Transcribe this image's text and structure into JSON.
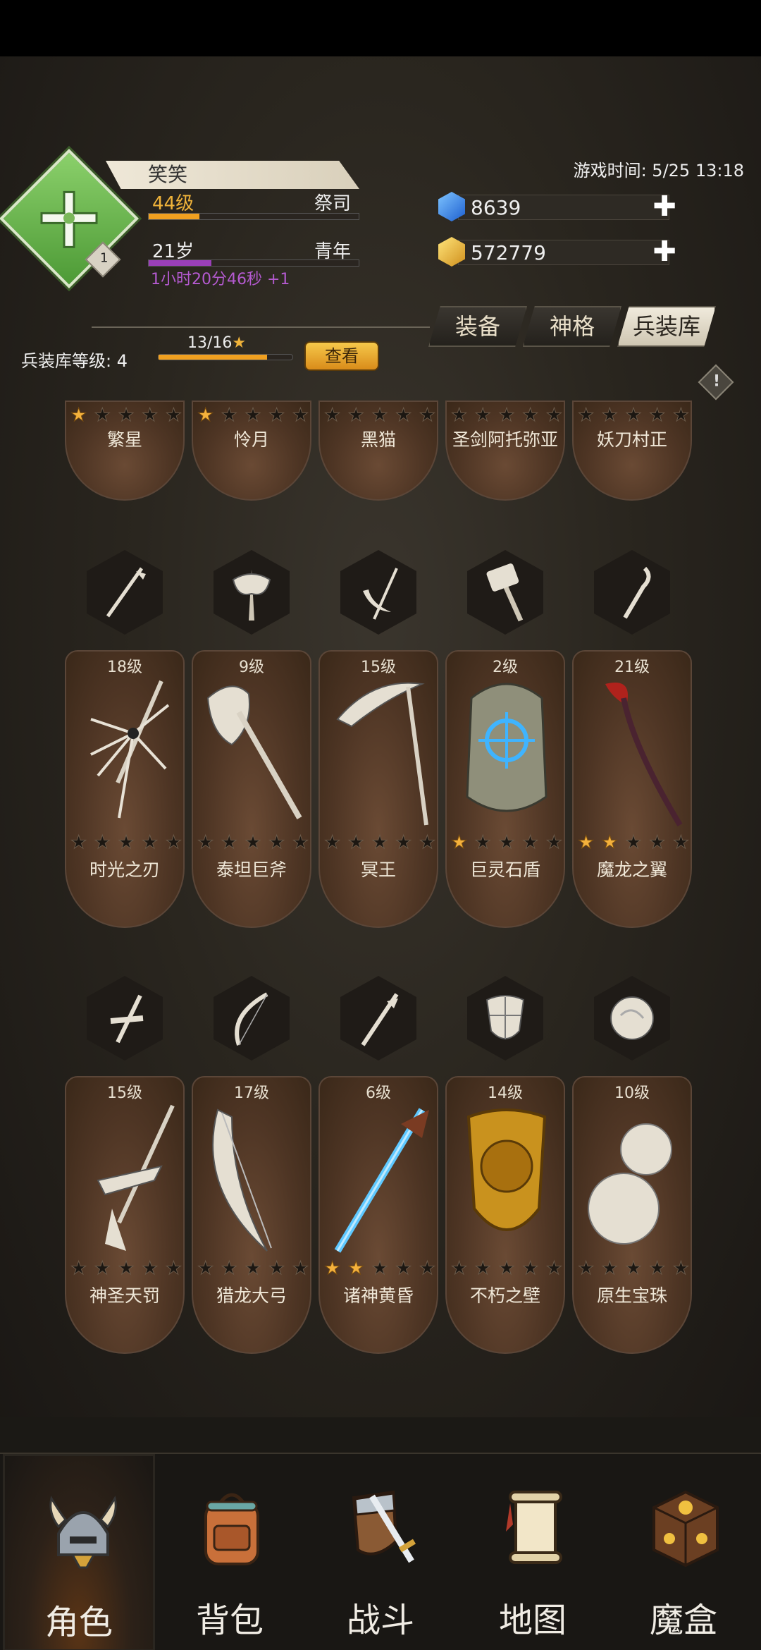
{
  "player": {
    "name": "笑笑",
    "level": "44级",
    "job": "祭司",
    "age": "21岁",
    "life_stage": "青年",
    "timer": "1小时20分46秒 +1",
    "rank": "1",
    "level_progress": 0.24,
    "age_progress": 0.3
  },
  "game_time": "游戏时间: 5/25 13:18",
  "currency": {
    "diamond": "8639",
    "gold": "572779",
    "plus": "✚"
  },
  "tabs": [
    {
      "label": "装备"
    },
    {
      "label": "神格"
    },
    {
      "label": "兵装库"
    }
  ],
  "arsenal": {
    "level_label": "兵装库等级:",
    "level": "4",
    "progress": "13/16",
    "star": "★",
    "progress_fraction": 0.8125,
    "view_button": "查看"
  },
  "info_icon": "!",
  "weapons_row0": [
    {
      "name": "繁星",
      "stars": 1
    },
    {
      "name": "怜月",
      "stars": 1
    },
    {
      "name": "黑猫",
      "stars": 0
    },
    {
      "name": "圣剑阿托弥亚",
      "stars": 0
    },
    {
      "name": "妖刀村正",
      "stars": 0
    }
  ],
  "weapons_row1": [
    {
      "level": "18级",
      "name": "时光之刃",
      "stars": 0
    },
    {
      "level": "9级",
      "name": "泰坦巨斧",
      "stars": 0
    },
    {
      "level": "15级",
      "name": "冥王",
      "stars": 0
    },
    {
      "level": "2级",
      "name": "巨灵石盾",
      "stars": 1
    },
    {
      "level": "21级",
      "name": "魔龙之翼",
      "stars": 2
    }
  ],
  "weapons_row2": [
    {
      "level": "15级",
      "name": "神圣天罚",
      "stars": 0
    },
    {
      "level": "17级",
      "name": "猎龙大弓",
      "stars": 0
    },
    {
      "level": "6级",
      "name": "诸神黄昏",
      "stars": 2
    },
    {
      "level": "14级",
      "name": "不朽之壁",
      "stars": 0
    },
    {
      "level": "10级",
      "name": "原生宝珠",
      "stars": 0
    }
  ],
  "nav": [
    {
      "label": "角色",
      "icon": "helmet-icon"
    },
    {
      "label": "背包",
      "icon": "backpack-icon"
    },
    {
      "label": "战斗",
      "icon": "sword-shield-icon"
    },
    {
      "label": "地图",
      "icon": "scroll-map-icon"
    },
    {
      "label": "魔盒",
      "icon": "magic-box-icon"
    }
  ],
  "colors": {
    "gold": "#f0b33a",
    "purple_timer": "#b45ad0",
    "card_brown": "#4e3524"
  }
}
